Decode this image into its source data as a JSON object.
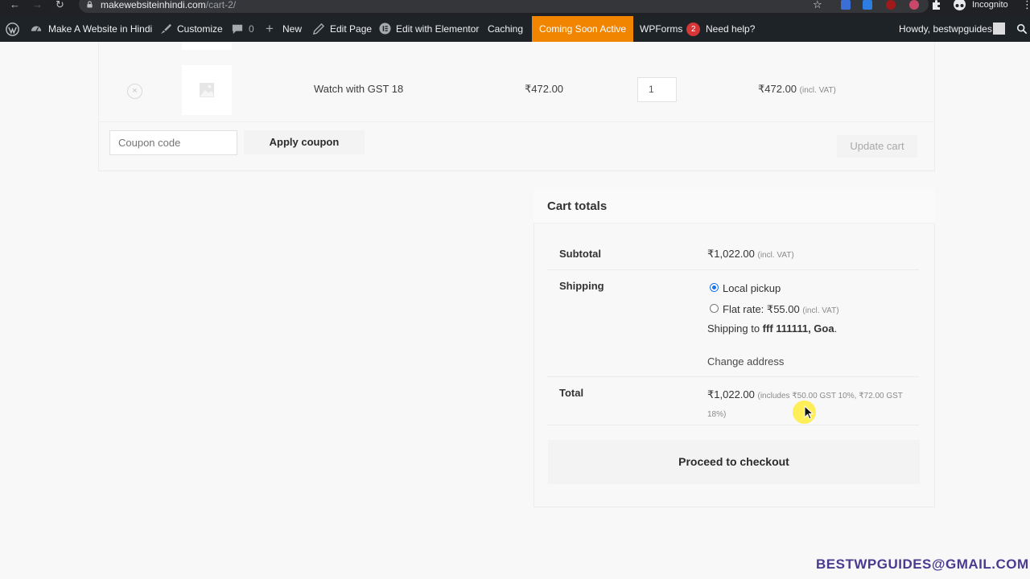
{
  "browser": {
    "url_host": "makewebsiteinhindi.com",
    "url_path": "/cart-2/",
    "profile_label": "Incognito"
  },
  "adminbar": {
    "site_name": "Make A Website in Hindi",
    "customize": "Customize",
    "comments_count": "0",
    "new": "New",
    "edit_page": "Edit Page",
    "edit_elementor": "Edit with Elementor",
    "caching": "Caching",
    "coming_soon": "Coming Soon Active",
    "wpforms": "WPForms",
    "wpforms_badge": "2",
    "need_help": "Need help?",
    "howdy": "Howdy, bestwpguides"
  },
  "cart": {
    "remove_symbol": "×",
    "item": {
      "name": "Watch with GST 18",
      "price": "₹472.00",
      "quantity": "1",
      "subtotal": "₹472.00",
      "subtotal_suffix": "(incl. VAT)"
    },
    "coupon_placeholder": "Coupon code",
    "apply_coupon": "Apply coupon",
    "update_cart": "Update cart"
  },
  "totals": {
    "title": "Cart totals",
    "subtotal_label": "Subtotal",
    "subtotal_value": "₹1,022.00",
    "subtotal_suffix": "(incl. VAT)",
    "shipping_label": "Shipping",
    "shipping_option_1": "Local pickup",
    "shipping_option_2_label": "Flat rate: ",
    "shipping_option_2_price": "₹55.00",
    "shipping_option_2_suffix": "(incl. VAT)",
    "shipping_to_prefix": "Shipping to ",
    "shipping_to_address": "fff 111111, Goa",
    "shipping_to_end": ".",
    "change_address": "Change address",
    "total_label": "Total",
    "total_value": "₹1,022.00",
    "total_includes": "(includes ₹50.00 GST 10%, ₹72.00 GST 18%)",
    "checkout": "Proceed to checkout"
  },
  "watermark": "BESTWPGUIDES@GMAIL.COM",
  "colors": {
    "admin_bar": "#1d2327",
    "coming_soon": "#f18500",
    "badge": "#d63638",
    "watermark": "#4b3a8f"
  }
}
